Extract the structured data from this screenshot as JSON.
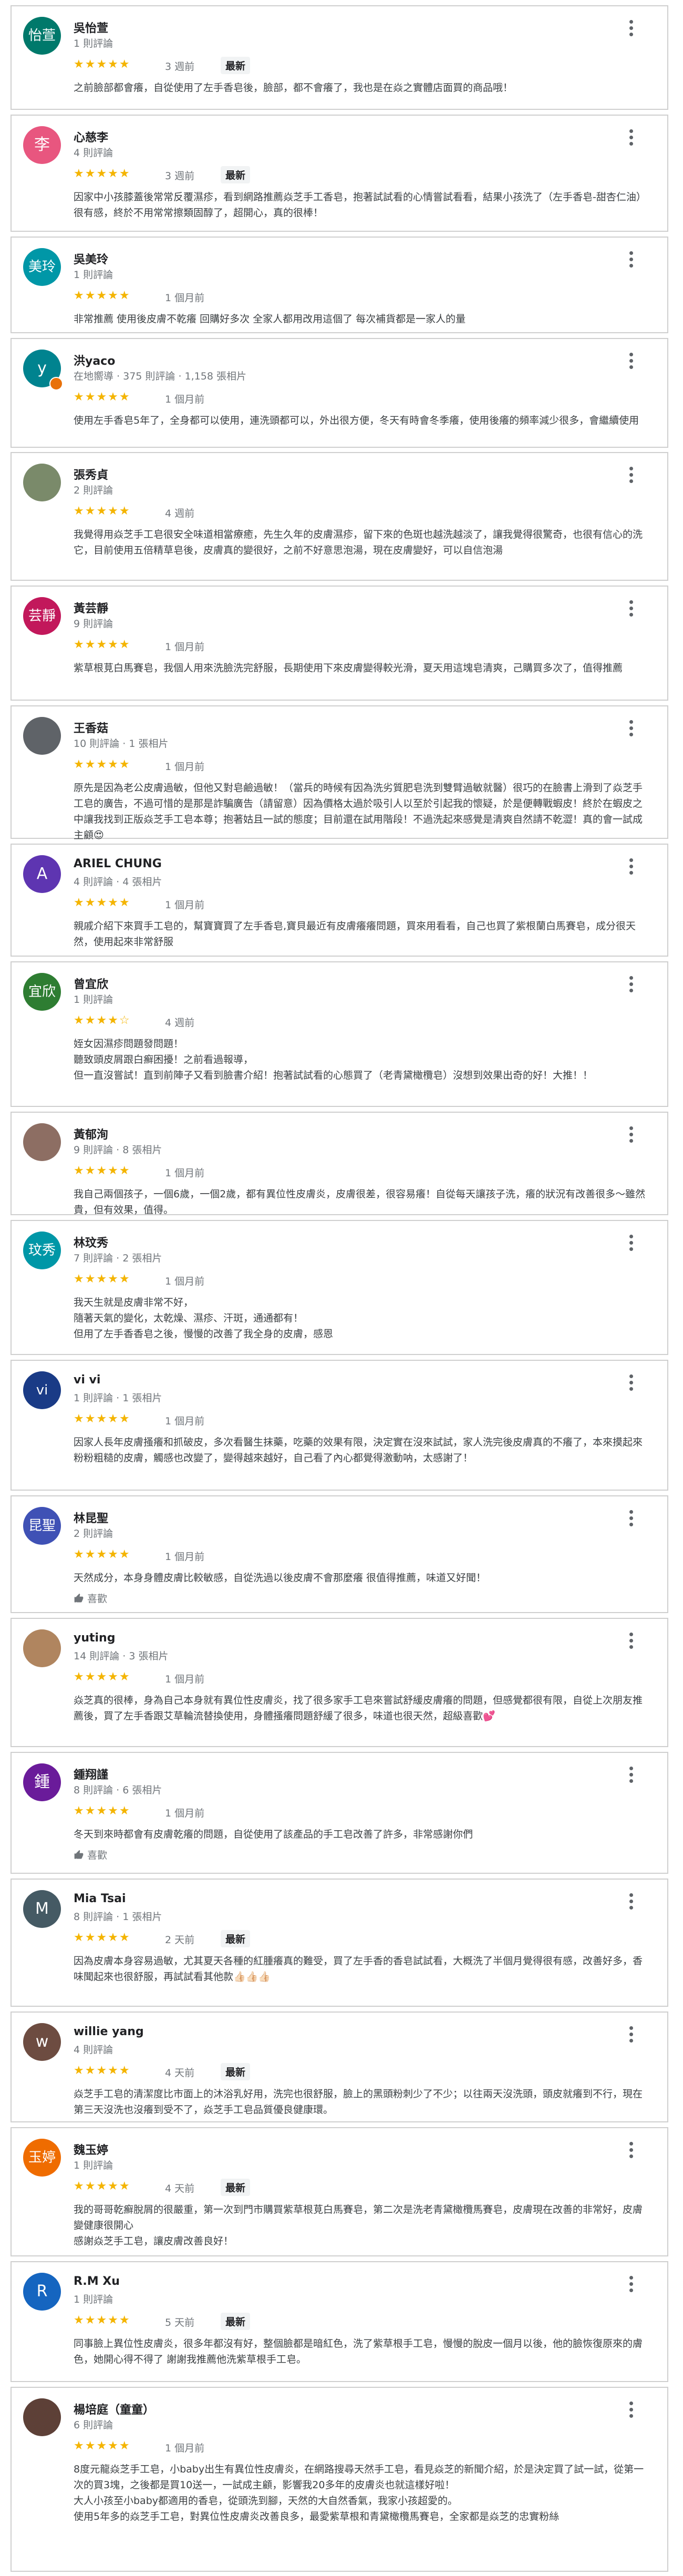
{
  "reviews": [
    {
      "name": "吳怡萱",
      "avatar_text": "怡萱",
      "avatar_color": "#00796b",
      "meta": "1 則評論",
      "rating": 5,
      "stars": "★★★★★",
      "date": "3 週前",
      "new": "最新",
      "text": "之前臉部都會癢，自從使用了左手香皂後，臉部，都不會癢了，我也是在焱之實體店面買的商品哦！"
    },
    {
      "name": "心慈李",
      "avatar_text": "李",
      "avatar_color": "#e8567f",
      "meta": "4 則評論",
      "rating": 5,
      "stars": "★★★★★",
      "date": "3 週前",
      "new": "最新",
      "text": "因家中小孩膝蓋後常常反覆濕疹，看到網路推薦焱芝手工香皂，抱著試試看的心情嘗試看看，結果小孩洗了（左手香皂-甜杏仁油）很有感，終於不用常常擦類固醇了，超開心，真的很棒！"
    },
    {
      "name": "吳美玲",
      "avatar_text": "美玲",
      "avatar_color": "#0097a7",
      "meta": "1 則評論",
      "rating": 5,
      "stars": "★★★★★",
      "date": "1 個月前",
      "new": "",
      "text": "非常推薦 使用後皮膚不乾癢 回購好多次 全家人都用改用這個了 每次補貨都是一家人的量"
    },
    {
      "name": "洪yaco",
      "avatar_text": "y",
      "avatar_color": "#00838f",
      "meta": "在地嚮導 · 375 則評論 · 1,158 張相片",
      "rating": 5,
      "stars": "★★★★★",
      "date": "1 個月前",
      "new": "",
      "text": "使用左手香皂5年了，全身都可以使用，連洗頭都可以，外出很方便，冬天有時會冬季癢，使用後癢的頻率減少很多，會繼續使用"
    },
    {
      "name": "張秀貞",
      "avatar_text": "",
      "avatar_color": "#7a8a6a",
      "meta": "2 則評論",
      "rating": 5,
      "stars": "★★★★★",
      "date": "4 週前",
      "new": "",
      "text": "我覺得用焱芝手工皂很安全味道相當療癒，先生久年的皮膚濕疹，留下來的色斑也越洗越淡了，讓我覺得很驚奇，也很有信心的洗它，目前使用五倍精草皂後，皮膚真的變很好，之前不好意思泡湯，現在皮膚變好，可以自信泡湯"
    },
    {
      "name": "黃芸靜",
      "avatar_text": "芸靜",
      "avatar_color": "#c2185b",
      "meta": "9 則評論",
      "rating": 5,
      "stars": "★★★★★",
      "date": "1 個月前",
      "new": "",
      "text": "紫草根莧白馬賽皂，我個人用來洗臉洗完舒服，長期使用下來皮膚變得較光滑，夏天用這塊皂清爽，己購買多次了，值得推薦"
    },
    {
      "name": "王香菇",
      "avatar_text": "",
      "avatar_color": "#5f6368",
      "meta": "10 則評論 · 1 張相片",
      "rating": 5,
      "stars": "★★★★★",
      "date": "1 個月前",
      "new": "",
      "text": "原先是因為老公皮膚過敏，但他又對皂鹼過敏！（當兵的時候有因為洗劣質肥皂洗到雙臂過敏就醫）很巧的在臉書上滑到了焱芝手工皂的廣告，不過可惜的是那是詐騙廣告（請留意）因為價格太過於吸引人以至於引起我的懷疑，於是便轉戰蝦皮！終於在蝦皮之中讓我找到正版焱芝手工皂本尊；抱著姑且一試的態度；目前還在試用階段！不過洗起來感覺是清爽自然請不乾澀！真的會一試成主顧😍"
    },
    {
      "name": "ARIEL CHUNG",
      "avatar_text": "A",
      "avatar_color": "#5e35b1",
      "meta": "4 則評論 · 4 張相片",
      "rating": 5,
      "stars": "★★★★★",
      "date": "1 個月前",
      "new": "",
      "text": "親戚介紹下來買手工皂的，幫寶寶買了左手香皂,寶貝最近有皮膚癢癢問題，買來用看看，自己也買了紫根蘭白馬賽皂，成分很天然，使用起來非常舒服"
    },
    {
      "name": "曾宜欣",
      "avatar_text": "宜欣",
      "avatar_color": "#2e7d32",
      "meta": "1 則評論",
      "rating": 4,
      "stars": "★★★★☆",
      "date": "4 週前",
      "new": "",
      "text": "姪女因濕疹問題發問題！\n聽致頭皮屑跟白癬困擾！之前看過報導，\n但一直沒嘗試！直到前陣子又看到臉書介紹！抱著試試看的心態買了（老青黛橄欖皂）沒想到效果出奇的好！大推！！"
    },
    {
      "name": "黃郁洵",
      "avatar_text": "",
      "avatar_color": "#8d6e63",
      "meta": "9 則評論 · 8 張相片",
      "rating": 5,
      "stars": "★★★★★",
      "date": "1 個月前",
      "new": "",
      "text": "我自己兩個孩子，一個6歲，一個2歲，都有異位性皮膚炎，皮膚很差，很容易癢！自從每天讓孩子洗，癢的狀況有改善很多～雖然貴，但有效果，值得。"
    },
    {
      "name": "林玟秀",
      "avatar_text": "玟秀",
      "avatar_color": "#0097a7",
      "meta": "7 則評論 · 2 張相片",
      "rating": 5,
      "stars": "★★★★★",
      "date": "1 個月前",
      "new": "",
      "text": "我天生就是皮膚非常不好，\n隨著天氣的變化，太乾燥、濕疹、汗斑，通通都有！\n但用了左手香香皂之後，慢慢的改善了我全身的皮膚，感恩"
    },
    {
      "name": "vi vi",
      "avatar_text": "vi",
      "avatar_color": "#1a3b86",
      "meta": "1 則評論 · 1 張相片",
      "rating": 5,
      "stars": "★★★★★",
      "date": "1 個月前",
      "new": "",
      "text": "因家人長年皮膚搔癢和抓破皮，多次看醫生抹藥，吃藥的效果有限，決定實在沒來試試，家人洗完後皮膚真的不癢了，本來摸起來粉粉粗糙的皮膚，觸感也改變了，變得越來越好，自己看了內心都覺得激動呐，太感謝了！"
    },
    {
      "name": "林昆聖",
      "avatar_text": "昆聖",
      "avatar_color": "#3f51b5",
      "meta": "2 則評論",
      "rating": 5,
      "stars": "★★★★★",
      "date": "1 個月前",
      "new": "",
      "text": "天然成分，本身身體皮膚比較敏感，自從洗過以後皮膚不會那麼癢 很值得推薦，味道又好聞！",
      "like": "喜歡"
    },
    {
      "name": "yuting",
      "avatar_text": "",
      "avatar_color": "#b0855f",
      "meta": "14 則評論 · 3 張相片",
      "rating": 5,
      "stars": "★★★★★",
      "date": "1 個月前",
      "new": "",
      "text": "焱芝真的很棒，身為自己本身就有異位性皮膚炎，找了很多家手工皂來嘗試舒緩皮膚癢的問題，但感覺都很有限，自從上次朋友推薦後，買了左手香跟艾草輪流替換使用，身體搔癢問題舒緩了很多，味道也很天然，超級喜歡💕"
    },
    {
      "name": "鍾翔謹",
      "avatar_text": "鍾",
      "avatar_color": "#6a1b9a",
      "meta": "8 則評論 · 6 張相片",
      "rating": 5,
      "stars": "★★★★★",
      "date": "1 個月前",
      "new": "",
      "text": "冬天到來時都會有皮膚乾癢的問題，自從使用了該產品的手工皂改善了許多，非常感謝你們",
      "like": "喜歡"
    },
    {
      "name": "Mia Tsai",
      "avatar_text": "M",
      "avatar_color": "#455a64",
      "meta": "8 則評論 · 1 張相片",
      "rating": 5,
      "stars": "★★★★★",
      "date": "2 天前",
      "new": "最新",
      "text": "因為皮膚本身容易過敏，尤其夏天各種的紅腫癢真的難受，買了左手香的香皂試試看，大概洗了半個月覺得很有感，改善好多，香味聞起來也很舒服，再試試看其他款👍🏻👍🏻👍🏻"
    },
    {
      "name": "willie yang",
      "avatar_text": "w",
      "avatar_color": "#6d4c41",
      "meta": "4 則評論",
      "rating": 5,
      "stars": "★★★★★",
      "date": "4 天前",
      "new": "最新",
      "text": "焱芝手工皂的清潔度比市面上的沐浴乳好用，洗完也很舒服，臉上的黑頭粉刺少了不少；以往兩天沒洗頭，頭皮就癢到不行，現在第三天沒洗也沒癢到受不了，焱芝手工皂品質優良健康環。"
    },
    {
      "name": "魏玉婷",
      "avatar_text": "玉婷",
      "avatar_color": "#ef6c00",
      "meta": "1 則評論",
      "rating": 5,
      "stars": "★★★★★",
      "date": "4 天前",
      "new": "最新",
      "text": "我的哥哥乾癬脫屑的很嚴重，第一次到門市購買紫草根莧白馬賽皂，第二次是洗老青黛橄欖馬賽皂，皮膚現在改善的非常好，皮膚變健康很開心\n感謝焱芝手工皂，讓皮膚改善良好！"
    },
    {
      "name": "R.M Xu",
      "avatar_text": "R",
      "avatar_color": "#1565c0",
      "meta": "1 則評論",
      "rating": 5,
      "stars": "★★★★★",
      "date": "5 天前",
      "new": "最新",
      "text": "同事臉上異位性皮膚炎，很多年都沒有好，整個臉都是暗紅色，洗了紫草根手工皂，慢慢的脫皮一個月以後，他的臉恢復原來的膚色，她開心得不得了 謝謝我推薦他洗紫草根手工皂。"
    },
    {
      "name": "楊培庭（童童）",
      "avatar_text": "",
      "avatar_color": "#5d4037",
      "meta": "6 則評論",
      "rating": 5,
      "stars": "★★★★★",
      "date": "1 個月前",
      "new": "",
      "text": "8度元龍焱芝手工皂，小baby出生有異位性皮膚炎，在網路搜尋天然手工皂，看見焱芝的新聞介紹，於是決定買了試一試，從第一次的買3塊，之後都是買10送一，一試成主顧，影響我20多年的皮膚炎也就這樣好啦！\n大人小孩至小baby都適用的香皂，從頭洗到腳，天然的大自然香氣，我家小孩超愛的。\n使用5年多的焱芝手工皂，對異位性皮膚炎改善良多，最愛紫草根和青黛橄欖馬賽皂，全家都是焱芝的忠實粉絲"
    }
  ]
}
